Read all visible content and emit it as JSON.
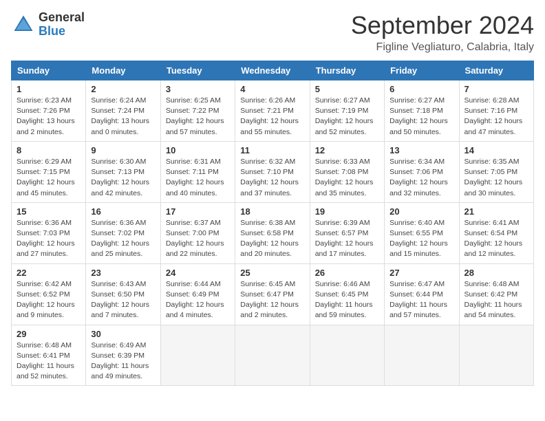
{
  "header": {
    "logo_general": "General",
    "logo_blue": "Blue",
    "month_title": "September 2024",
    "location": "Figline Vegliaturo, Calabria, Italy"
  },
  "weekdays": [
    "Sunday",
    "Monday",
    "Tuesday",
    "Wednesday",
    "Thursday",
    "Friday",
    "Saturday"
  ],
  "weeks": [
    [
      {
        "day": 1,
        "sunrise": "6:23 AM",
        "sunset": "7:26 PM",
        "daylight": "13 hours and 2 minutes."
      },
      {
        "day": 2,
        "sunrise": "6:24 AM",
        "sunset": "7:24 PM",
        "daylight": "13 hours and 0 minutes."
      },
      {
        "day": 3,
        "sunrise": "6:25 AM",
        "sunset": "7:22 PM",
        "daylight": "12 hours and 57 minutes."
      },
      {
        "day": 4,
        "sunrise": "6:26 AM",
        "sunset": "7:21 PM",
        "daylight": "12 hours and 55 minutes."
      },
      {
        "day": 5,
        "sunrise": "6:27 AM",
        "sunset": "7:19 PM",
        "daylight": "12 hours and 52 minutes."
      },
      {
        "day": 6,
        "sunrise": "6:27 AM",
        "sunset": "7:18 PM",
        "daylight": "12 hours and 50 minutes."
      },
      {
        "day": 7,
        "sunrise": "6:28 AM",
        "sunset": "7:16 PM",
        "daylight": "12 hours and 47 minutes."
      }
    ],
    [
      {
        "day": 8,
        "sunrise": "6:29 AM",
        "sunset": "7:15 PM",
        "daylight": "12 hours and 45 minutes."
      },
      {
        "day": 9,
        "sunrise": "6:30 AM",
        "sunset": "7:13 PM",
        "daylight": "12 hours and 42 minutes."
      },
      {
        "day": 10,
        "sunrise": "6:31 AM",
        "sunset": "7:11 PM",
        "daylight": "12 hours and 40 minutes."
      },
      {
        "day": 11,
        "sunrise": "6:32 AM",
        "sunset": "7:10 PM",
        "daylight": "12 hours and 37 minutes."
      },
      {
        "day": 12,
        "sunrise": "6:33 AM",
        "sunset": "7:08 PM",
        "daylight": "12 hours and 35 minutes."
      },
      {
        "day": 13,
        "sunrise": "6:34 AM",
        "sunset": "7:06 PM",
        "daylight": "12 hours and 32 minutes."
      },
      {
        "day": 14,
        "sunrise": "6:35 AM",
        "sunset": "7:05 PM",
        "daylight": "12 hours and 30 minutes."
      }
    ],
    [
      {
        "day": 15,
        "sunrise": "6:36 AM",
        "sunset": "7:03 PM",
        "daylight": "12 hours and 27 minutes."
      },
      {
        "day": 16,
        "sunrise": "6:36 AM",
        "sunset": "7:02 PM",
        "daylight": "12 hours and 25 minutes."
      },
      {
        "day": 17,
        "sunrise": "6:37 AM",
        "sunset": "7:00 PM",
        "daylight": "12 hours and 22 minutes."
      },
      {
        "day": 18,
        "sunrise": "6:38 AM",
        "sunset": "6:58 PM",
        "daylight": "12 hours and 20 minutes."
      },
      {
        "day": 19,
        "sunrise": "6:39 AM",
        "sunset": "6:57 PM",
        "daylight": "12 hours and 17 minutes."
      },
      {
        "day": 20,
        "sunrise": "6:40 AM",
        "sunset": "6:55 PM",
        "daylight": "12 hours and 15 minutes."
      },
      {
        "day": 21,
        "sunrise": "6:41 AM",
        "sunset": "6:54 PM",
        "daylight": "12 hours and 12 minutes."
      }
    ],
    [
      {
        "day": 22,
        "sunrise": "6:42 AM",
        "sunset": "6:52 PM",
        "daylight": "12 hours and 9 minutes."
      },
      {
        "day": 23,
        "sunrise": "6:43 AM",
        "sunset": "6:50 PM",
        "daylight": "12 hours and 7 minutes."
      },
      {
        "day": 24,
        "sunrise": "6:44 AM",
        "sunset": "6:49 PM",
        "daylight": "12 hours and 4 minutes."
      },
      {
        "day": 25,
        "sunrise": "6:45 AM",
        "sunset": "6:47 PM",
        "daylight": "12 hours and 2 minutes."
      },
      {
        "day": 26,
        "sunrise": "6:46 AM",
        "sunset": "6:45 PM",
        "daylight": "11 hours and 59 minutes."
      },
      {
        "day": 27,
        "sunrise": "6:47 AM",
        "sunset": "6:44 PM",
        "daylight": "11 hours and 57 minutes."
      },
      {
        "day": 28,
        "sunrise": "6:48 AM",
        "sunset": "6:42 PM",
        "daylight": "11 hours and 54 minutes."
      }
    ],
    [
      {
        "day": 29,
        "sunrise": "6:48 AM",
        "sunset": "6:41 PM",
        "daylight": "11 hours and 52 minutes."
      },
      {
        "day": 30,
        "sunrise": "6:49 AM",
        "sunset": "6:39 PM",
        "daylight": "11 hours and 49 minutes."
      },
      null,
      null,
      null,
      null,
      null
    ]
  ]
}
